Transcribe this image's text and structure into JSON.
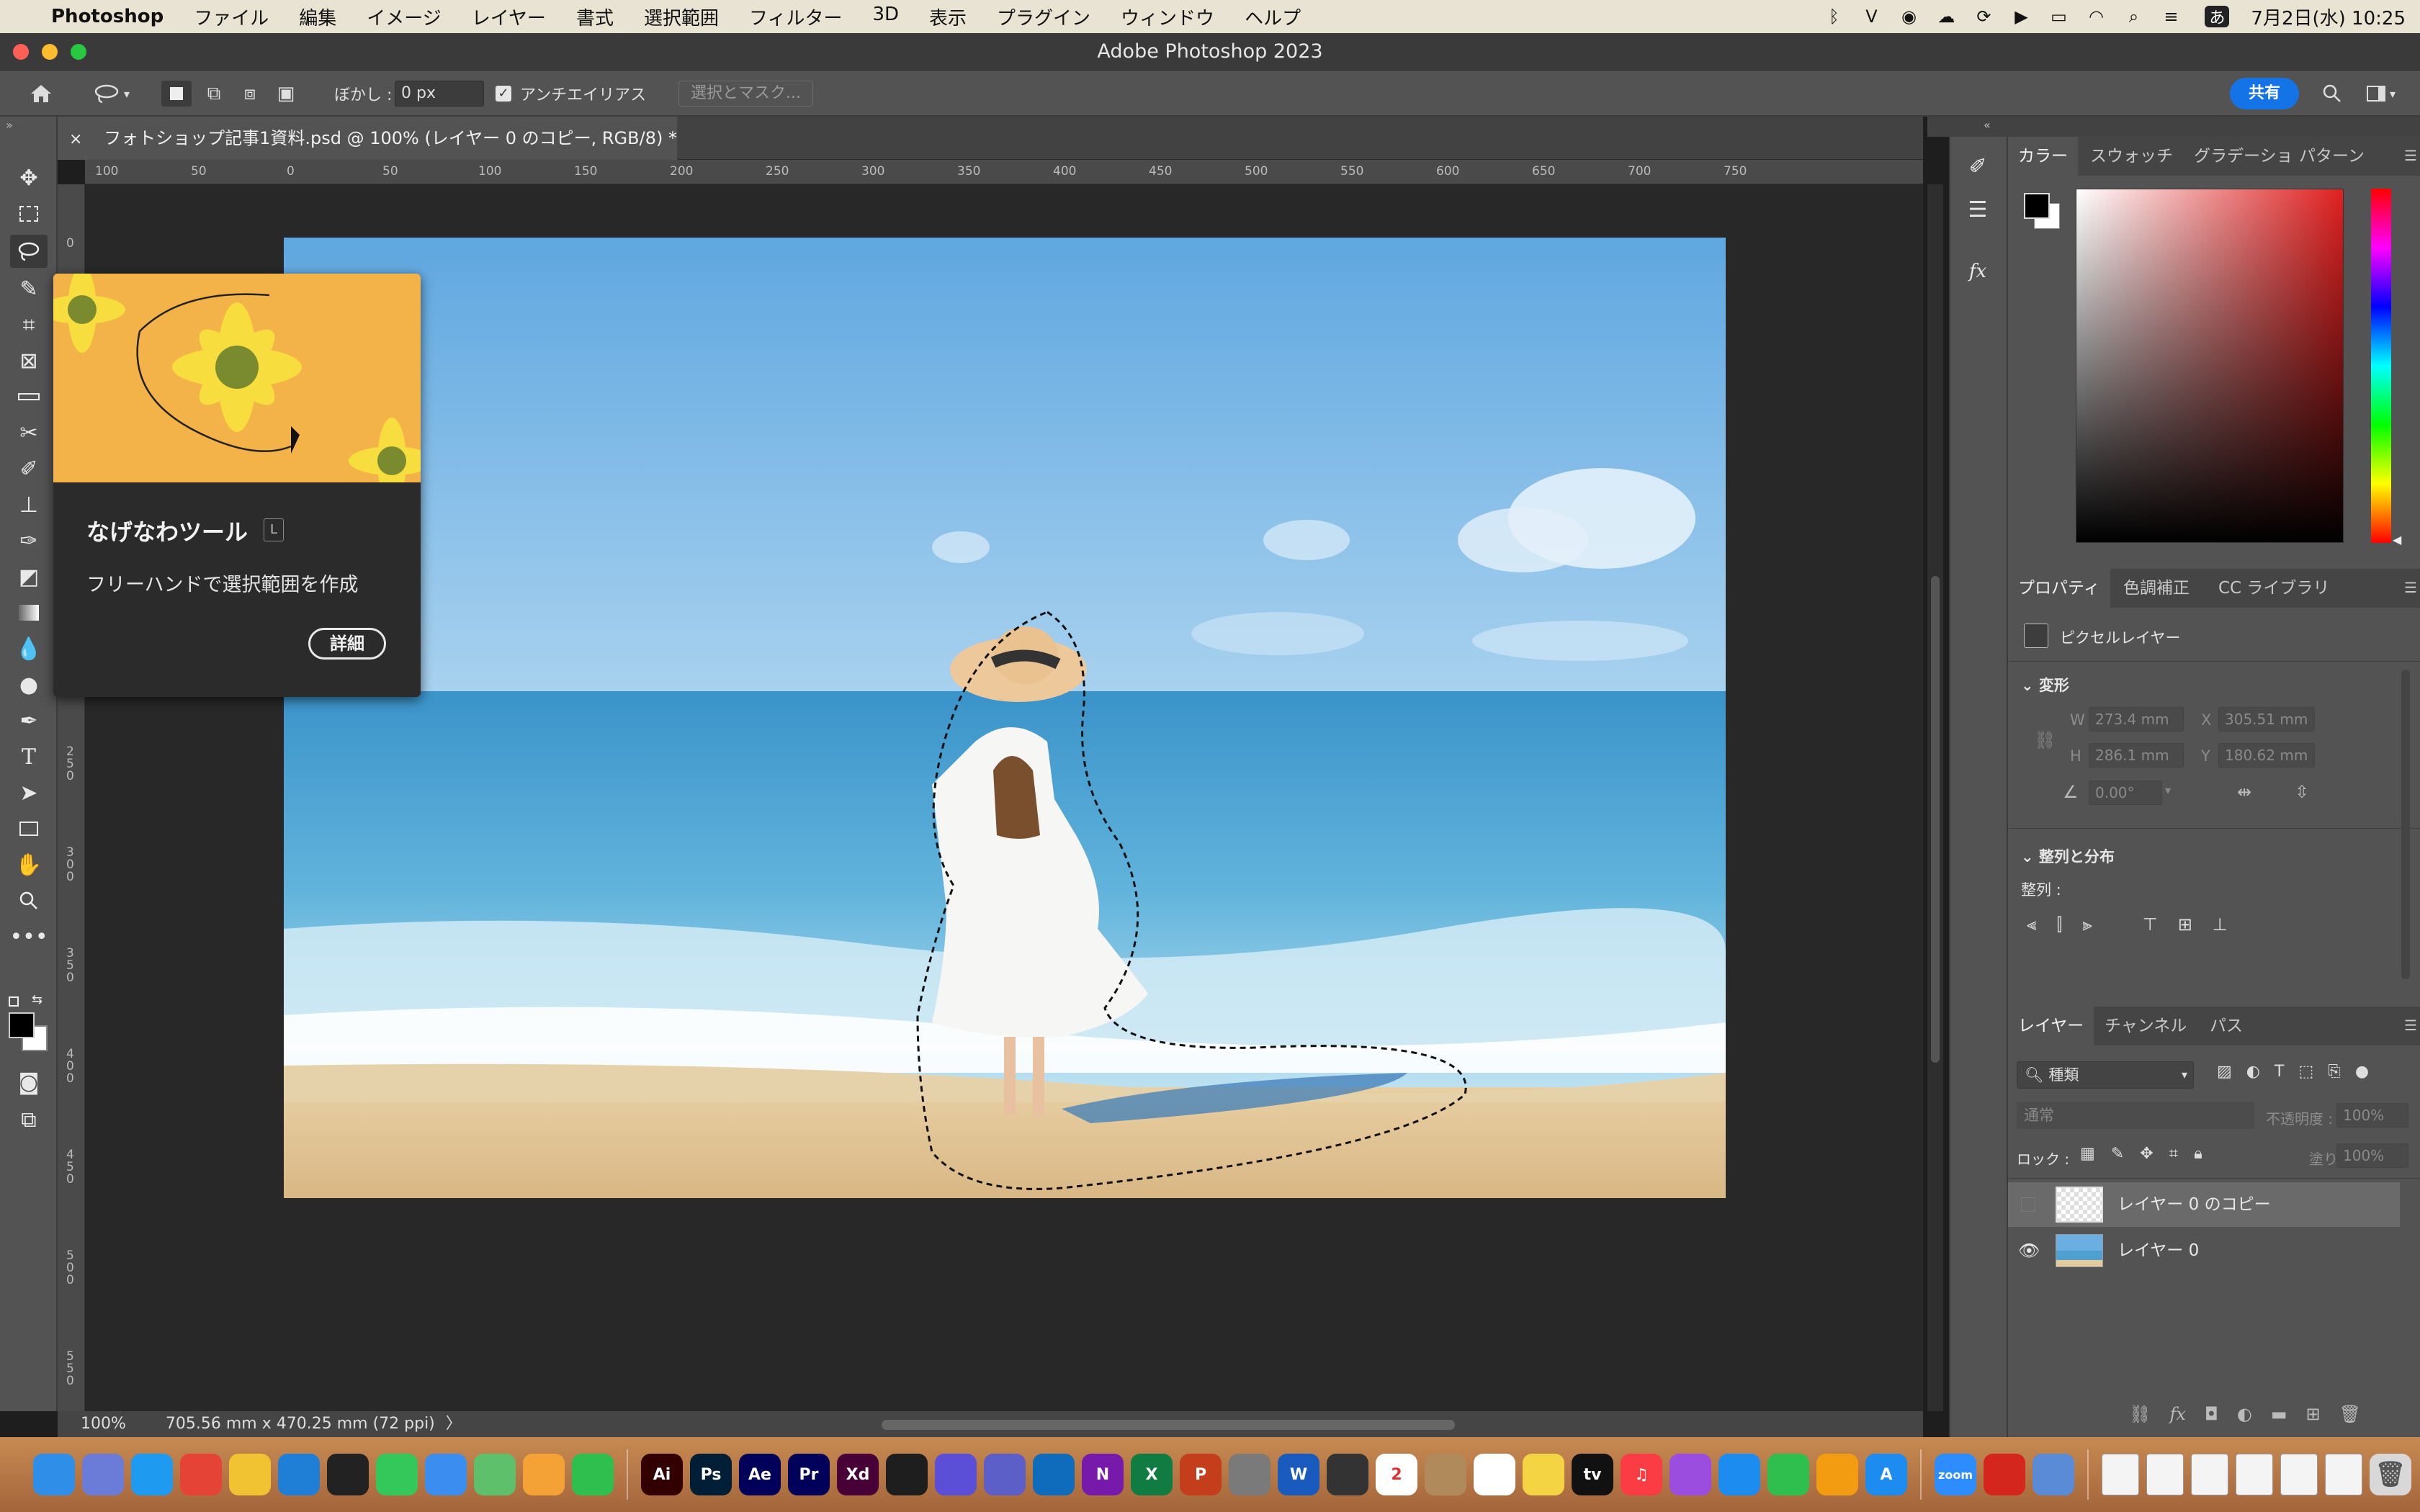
{
  "menubar": {
    "app": "Photoshop",
    "items": [
      "ファイル",
      "編集",
      "イメージ",
      "レイヤー",
      "書式",
      "選択範囲",
      "フィルター",
      "3D",
      "表示",
      "プラグイン",
      "ウィンドウ",
      "ヘルプ"
    ],
    "date_time": "7月2日(水) 10:25",
    "ime": "あ",
    "status_icons": [
      "bluetooth-icon",
      "vpn-icon",
      "zoom-icon",
      "creative-cloud-icon",
      "sync-icon",
      "play-icon",
      "battery-icon",
      "wifi-icon",
      "search-icon",
      "control-center-icon"
    ]
  },
  "window": {
    "title": "Adobe Photoshop 2023"
  },
  "options": {
    "feather_label": "ぼかし :",
    "feather_value": "0 px",
    "antialias_label": "アンチエイリアス",
    "antialias_checked": true,
    "select_mask": "選択とマスク...",
    "share": "共有"
  },
  "document": {
    "tab": "フォトショップ記事1資料.psd @ 100% (レイヤー 0 のコピー, RGB/8) *",
    "ruler_h": [
      "100",
      "50",
      "0",
      "50",
      "100",
      "150",
      "200",
      "250",
      "300",
      "350",
      "400",
      "450",
      "500",
      "550",
      "600",
      "650",
      "700",
      "750"
    ],
    "ruler_v": [
      "0",
      "2\n5\n0",
      "3\n0\n0",
      "3\n5\n0",
      "4\n0\n0",
      "4\n5\n0",
      "5\n0\n0",
      "5\n5\n0"
    ],
    "zoom": "100%",
    "dimensions": "705.56 mm x 470.25 mm (72 ppi)"
  },
  "tooltip": {
    "title": "なげなわツール",
    "shortcut": "L",
    "description": "フリーハンドで選択範囲を作成",
    "details": "詳細"
  },
  "color_panel": {
    "tabs": [
      "カラー",
      "スウォッチ",
      "グラデーショ",
      "パターン"
    ],
    "active": 0,
    "fg": "#000000",
    "bg": "#ffffff",
    "hue": "#e02020"
  },
  "properties_panel": {
    "tabs": [
      "プロパティ",
      "色調補正",
      "CC ライブラリ"
    ],
    "type": "ピクセルレイヤー",
    "transform_title": "変形",
    "w_label": "W",
    "w": "273.4 mm",
    "x_label": "X",
    "x": "305.51 mm",
    "h_label": "H",
    "h": "286.1 mm",
    "y_label": "Y",
    "y": "180.62 mm",
    "angle": "0.00°",
    "align_title": "整列と分布",
    "align_label": "整列 :"
  },
  "layers_panel": {
    "tabs": [
      "レイヤー",
      "チャンネル",
      "パス"
    ],
    "filter": "種類",
    "blend": "通常",
    "opacity_label": "不透明度 :",
    "opacity": "100%",
    "lock_label": "ロック :",
    "fill_label": "塗り :",
    "fill": "100%",
    "layers": [
      {
        "name": "レイヤー 0 のコピー",
        "visible": false,
        "selected": true
      },
      {
        "name": "レイヤー 0",
        "visible": true,
        "selected": false
      }
    ]
  },
  "dock": {
    "apps": [
      {
        "icon": "finder-icon",
        "label": "",
        "color": "#2f8fe8"
      },
      {
        "icon": "launchpad-icon",
        "label": "",
        "color": "#6b7bd8"
      },
      {
        "icon": "safari-icon",
        "label": "",
        "color": "#1e9bf0"
      },
      {
        "icon": "chrome-icon",
        "label": "",
        "color": "#e44335"
      },
      {
        "icon": "cyberduck-icon",
        "label": "",
        "color": "#f1c232"
      },
      {
        "icon": "vscode-icon",
        "label": "",
        "color": "#1f7ed6"
      },
      {
        "icon": "compass-icon",
        "label": "",
        "color": "#222222"
      },
      {
        "icon": "messages-icon",
        "label": "",
        "color": "#34c759"
      },
      {
        "icon": "mail-icon",
        "label": "",
        "color": "#3b8ef0"
      },
      {
        "icon": "maps-icon",
        "label": "",
        "color": "#5ec06a"
      },
      {
        "icon": "photos-icon",
        "label": "",
        "color": "#f4a235"
      },
      {
        "icon": "facetime-icon",
        "label": "",
        "color": "#2fbf4f"
      },
      {
        "icon": "illustrator-icon",
        "label": "Ai",
        "color": "#330000"
      },
      {
        "icon": "photoshop-icon",
        "label": "Ps",
        "color": "#001e36"
      },
      {
        "icon": "aftereffects-icon",
        "label": "Ae",
        "color": "#00005b"
      },
      {
        "icon": "premiere-icon",
        "label": "Pr",
        "color": "#00005b"
      },
      {
        "icon": "xd-icon",
        "label": "Xd",
        "color": "#470137"
      },
      {
        "icon": "figma-icon",
        "label": "",
        "color": "#1e1e1e"
      },
      {
        "icon": "star-app-icon",
        "label": "",
        "color": "#5b4fd8"
      },
      {
        "icon": "teams-icon",
        "label": "",
        "color": "#5b5fc7"
      },
      {
        "icon": "outlook-icon",
        "label": "",
        "color": "#0f6cbd"
      },
      {
        "icon": "onenote-icon",
        "label": "N",
        "color": "#7719aa"
      },
      {
        "icon": "excel-icon",
        "label": "X",
        "color": "#107c41"
      },
      {
        "icon": "powerpoint-icon",
        "label": "P",
        "color": "#c43e1c"
      },
      {
        "icon": "system-settings-icon",
        "label": "",
        "color": "#7a7a7a"
      },
      {
        "icon": "word-icon",
        "label": "W",
        "color": "#185abd"
      },
      {
        "icon": "numbers-grid-icon",
        "label": "",
        "color": "#333333"
      },
      {
        "icon": "calendar-icon",
        "label": "2",
        "color": "#ffffff"
      },
      {
        "icon": "contacts-icon",
        "label": "",
        "color": "#b08a5a"
      },
      {
        "icon": "reminders-icon",
        "label": "",
        "color": "#ffffff"
      },
      {
        "icon": "notes-icon",
        "label": "",
        "color": "#f5d443"
      },
      {
        "icon": "appletv-icon",
        "label": "tv",
        "color": "#111111"
      },
      {
        "icon": "music-icon",
        "label": "♫",
        "color": "#fc3c44"
      },
      {
        "icon": "podcasts-icon",
        "label": "",
        "color": "#9b4de0"
      },
      {
        "icon": "keynote-icon",
        "label": "",
        "color": "#1c8cf0"
      },
      {
        "icon": "numbers-icon",
        "label": "",
        "color": "#2fbf4f"
      },
      {
        "icon": "pages-icon",
        "label": "",
        "color": "#f39c12"
      },
      {
        "icon": "appstore-icon",
        "label": "A",
        "color": "#1c8cf0"
      },
      {
        "icon": "zoom-app-icon",
        "label": "zoom",
        "color": "#2d8cff"
      },
      {
        "icon": "acrobat-icon",
        "label": "",
        "color": "#d4261c"
      },
      {
        "icon": "preview-icon",
        "label": "",
        "color": "#5a8bd6"
      }
    ],
    "docs": [
      "doc-thumb-icon",
      "doc-thumb-icon",
      "doc-thumb-icon",
      "doc-thumb-icon",
      "doc-thumb-icon",
      "doc-thumb-icon"
    ],
    "trash": "trash-icon"
  }
}
